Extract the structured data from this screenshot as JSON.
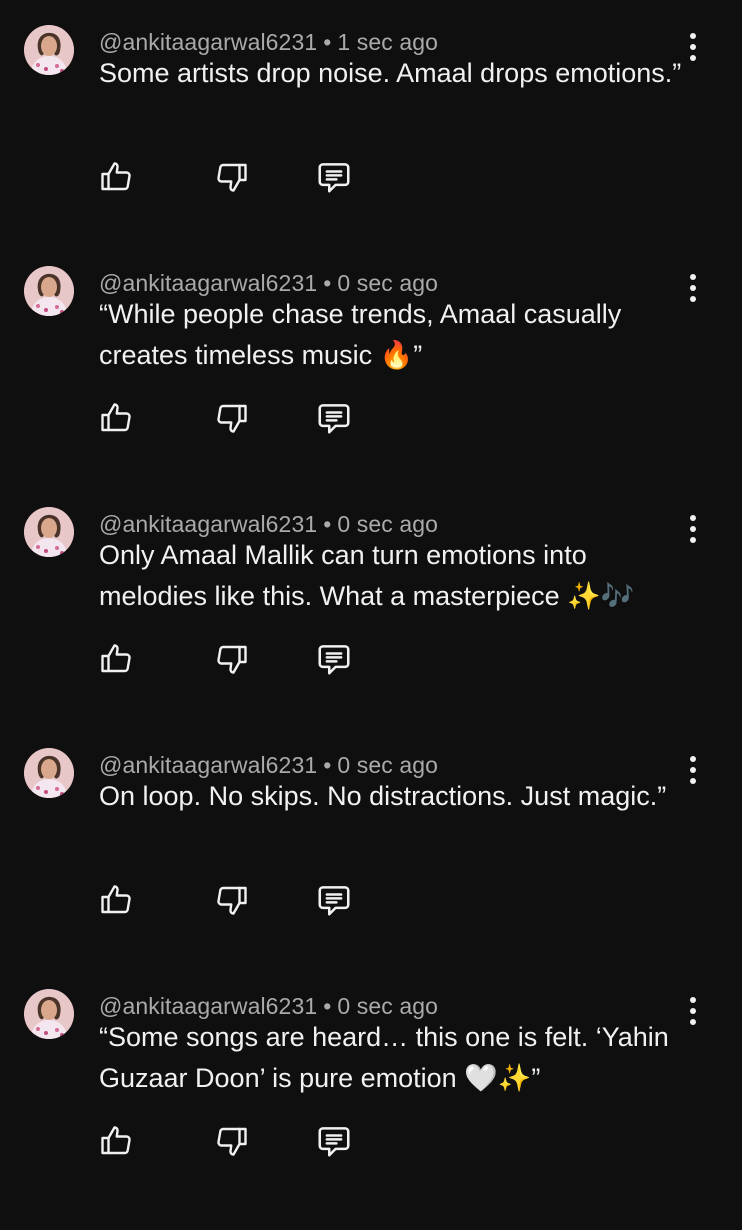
{
  "comments": [
    {
      "author": "@ankitaagarwal6231",
      "separator": "•",
      "time": "1 sec ago",
      "text": "Some artists drop noise. Amaal drops emotions.”"
    },
    {
      "author": "@ankitaagarwal6231",
      "separator": "•",
      "time": "0 sec ago",
      "text": "“While people chase trends, Amaal casually creates timeless music 🔥”"
    },
    {
      "author": "@ankitaagarwal6231",
      "separator": "•",
      "time": "0 sec ago",
      "text": "Only Amaal Mallik can turn emotions into melodies like this. What a masterpiece ✨🎶"
    },
    {
      "author": "@ankitaagarwal6231",
      "separator": "•",
      "time": "0 sec ago",
      "text": "On loop. No skips. No distractions. Just magic.”"
    },
    {
      "author": "@ankitaagarwal6231",
      "separator": "•",
      "time": "0 sec ago",
      "text": "“Some songs are heard… this one is felt. ‘Yahin Guzaar Doon’ is pure emotion 🤍✨”"
    }
  ],
  "icons": {
    "like": "thumbs-up-icon",
    "dislike": "thumbs-down-icon",
    "reply": "reply-icon",
    "more": "more-vertical-icon"
  },
  "colors": {
    "background": "#0f0f0f",
    "text": "#f1f1f1",
    "meta": "#aaaaaa"
  }
}
